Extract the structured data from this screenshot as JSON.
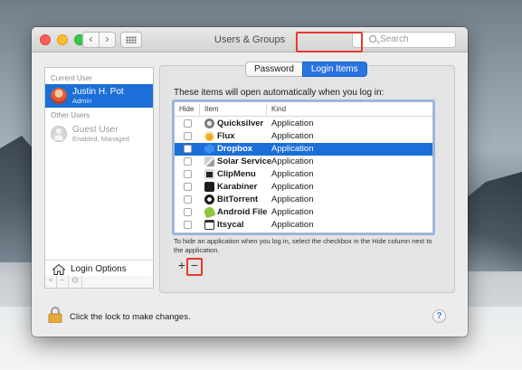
{
  "window": {
    "title": "Users & Groups",
    "search_placeholder": "Search"
  },
  "nav": {
    "back_glyph": "‹",
    "forward_glyph": "›"
  },
  "sidebar": {
    "current_user_label": "Current User",
    "current_user": {
      "name": "Justin H. Pot",
      "role": "Admin"
    },
    "other_users_label": "Other Users",
    "other_users": [
      {
        "name": "Guest User",
        "role": "Enabled, Managed"
      }
    ],
    "login_options_label": "Login Options",
    "tools": {
      "add": "+",
      "remove": "−",
      "gear": "⚙"
    }
  },
  "tabs": [
    {
      "label": "Password",
      "selected": false
    },
    {
      "label": "Login Items",
      "selected": true
    }
  ],
  "main": {
    "intro": "These items will open automatically when you log in:",
    "columns": {
      "hide": "Hide",
      "item": "Item",
      "kind": "Kind"
    },
    "items": [
      {
        "name": "Quicksilver",
        "kind": "Application",
        "icon": "quicksilver-icon"
      },
      {
        "name": "Flux",
        "kind": "Application",
        "icon": "flux-icon"
      },
      {
        "name": "Dropbox",
        "kind": "Application",
        "icon": "dropbox-icon",
        "selected": true
      },
      {
        "name": "Solar Service",
        "kind": "Application",
        "icon": "solar-service-icon"
      },
      {
        "name": "ClipMenu",
        "kind": "Application",
        "icon": "clipmenu-icon"
      },
      {
        "name": "Karabiner",
        "kind": "Application",
        "icon": "karabiner-icon"
      },
      {
        "name": "BitTorrent",
        "kind": "Application",
        "icon": "bittorrent-icon"
      },
      {
        "name": "Android File",
        "kind": "Application",
        "icon": "android-file-icon"
      },
      {
        "name": "Itsycal",
        "kind": "Application",
        "icon": "itsycal-icon"
      }
    ],
    "hint": "To hide an application when you log in, select the checkbox in the Hide column next to the application.",
    "add_label": "+",
    "remove_label": "−"
  },
  "footer": {
    "lock_text": "Click the lock to make changes.",
    "help_label": "?"
  },
  "colors": {
    "selection": "#1c6fd6",
    "annotation": "#e53a30"
  }
}
